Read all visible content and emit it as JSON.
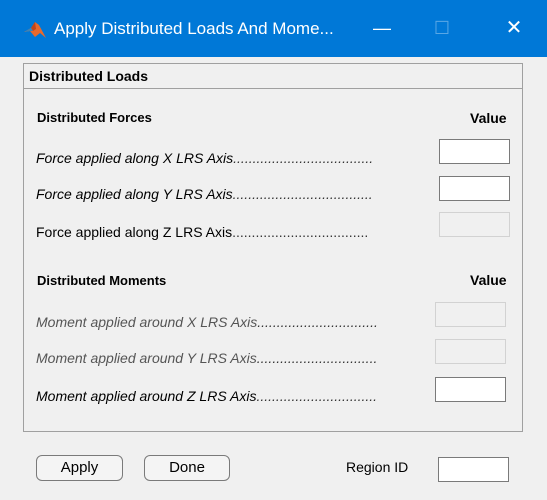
{
  "window": {
    "title": "Apply Distributed Loads And Mome...",
    "minimize_glyph": "—",
    "maximize_glyph": "☐",
    "close_glyph": "✕",
    "icon": "matlab-logo-icon",
    "titlebar_color": "#0078d7"
  },
  "panel": {
    "title": "Distributed Loads"
  },
  "forces": {
    "section_title": "Distributed Forces",
    "value_header": "Value",
    "rows": [
      {
        "label": "Force applied along X LRS Axis",
        "dots": "....................................",
        "value": "",
        "enabled": true
      },
      {
        "label": "Force applied along Y LRS Axis",
        "dots": "....................................",
        "value": "",
        "enabled": true
      },
      {
        "label": "Force applied along Z LRS Axis",
        "dots": "...................................",
        "value": "",
        "enabled": false
      }
    ]
  },
  "moments": {
    "section_title": "Distributed Moments",
    "value_header": "Value",
    "rows": [
      {
        "label": "Moment applied around X LRS Axis",
        "dots": "...............................",
        "value": "",
        "enabled": false
      },
      {
        "label": "Moment applied around Y LRS Axis",
        "dots": "...............................",
        "value": "",
        "enabled": false
      },
      {
        "label": "Moment applied around Z LRS Axis",
        "dots": "...............................",
        "value": "",
        "enabled": true
      }
    ]
  },
  "footer": {
    "apply_label": "Apply",
    "done_label": "Done",
    "region_label": "Region ID",
    "region_value": ""
  }
}
